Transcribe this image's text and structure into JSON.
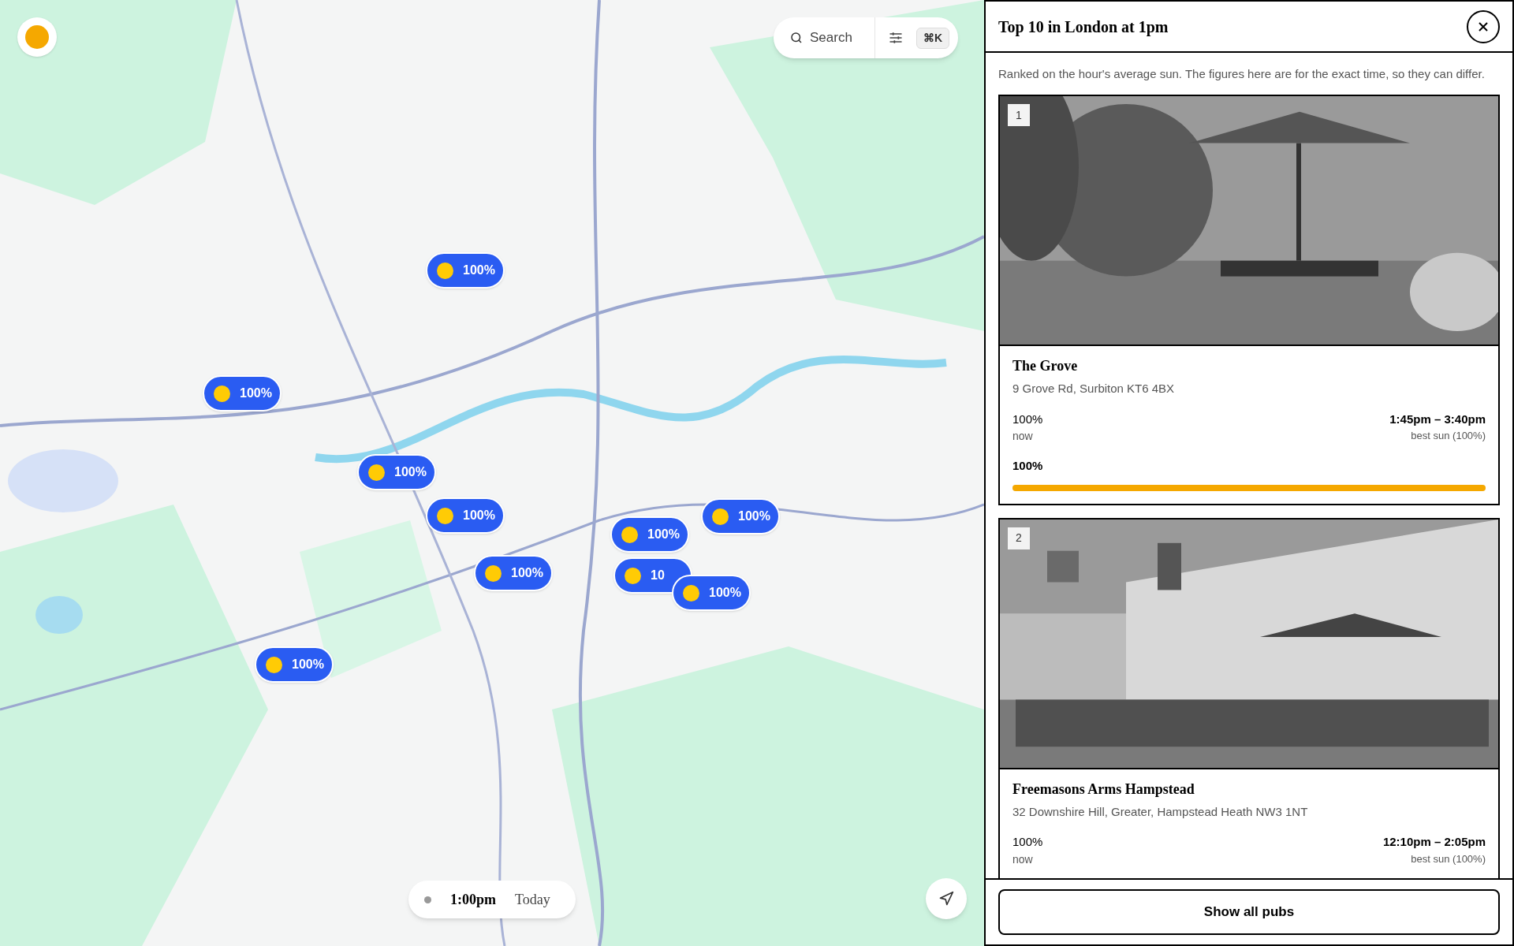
{
  "search": {
    "placeholder": "Search",
    "shortcut": "⌘K"
  },
  "markers": [
    {
      "label": "100%"
    },
    {
      "label": "100%"
    },
    {
      "label": "100%"
    },
    {
      "label": "100%"
    },
    {
      "label": "100%"
    },
    {
      "label": "10"
    },
    {
      "label": "100%"
    },
    {
      "label": "100%"
    },
    {
      "label": "100%"
    },
    {
      "label": "100%"
    }
  ],
  "time_pill": {
    "time": "1:00pm",
    "day": "Today"
  },
  "panel": {
    "title": "Top 10 in London at 1pm",
    "description": "Ranked on the hour's average sun. The figures here are for the exact time, so they can differ.",
    "pubs": [
      {
        "rank": "1",
        "name": "The Grove",
        "address": "9 Grove Rd, Surbiton KT6 4BX",
        "now_value": "100%",
        "now_label": "now",
        "best_time": "1:45pm – 3:40pm",
        "best_label": "best sun (100%)",
        "level_label": "100%",
        "level": 1
      },
      {
        "rank": "2",
        "name": "Freemasons Arms Hampstead",
        "address": "32 Downshire Hill, Greater, Hampstead Heath NW3 1NT",
        "now_value": "100%",
        "now_label": "now",
        "best_time": "12:10pm – 2:05pm",
        "best_label": "best sun (100%)"
      }
    ],
    "show_all_button": "Show all pubs"
  }
}
